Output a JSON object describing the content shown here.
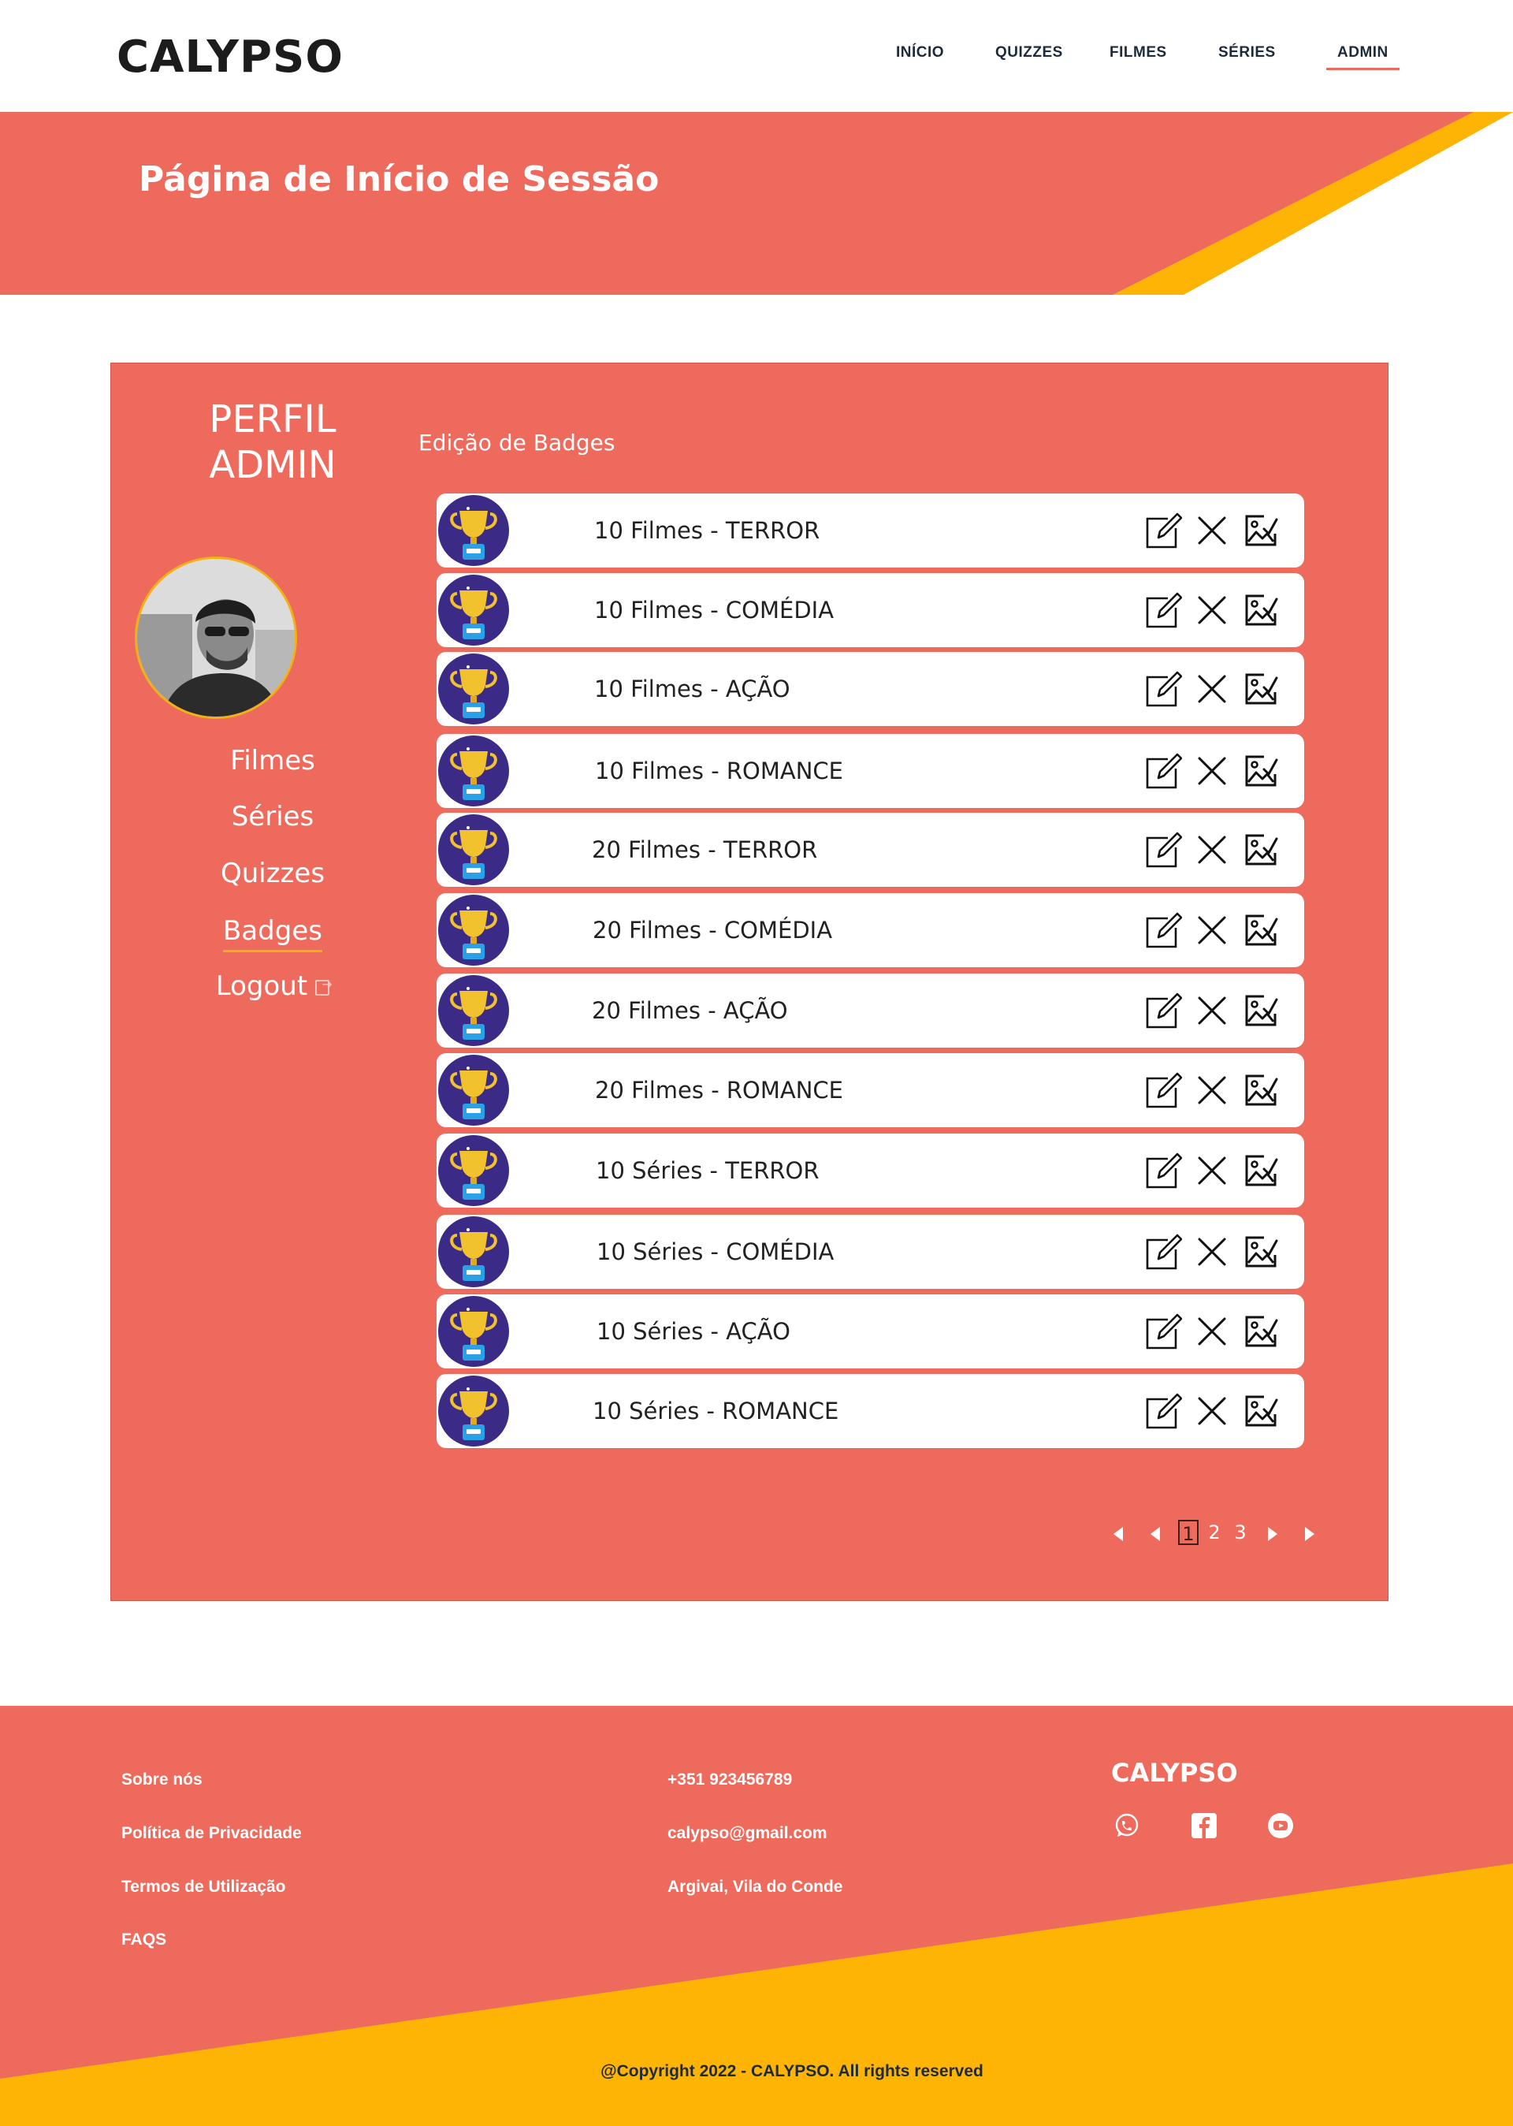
{
  "header": {
    "logo": "CALYPSO",
    "nav": [
      "INÍCIO",
      "QUIZZES",
      "FILMES",
      "SÉRIES",
      "ADMIN"
    ],
    "active_nav": "ADMIN"
  },
  "banner": {
    "title": "Página de Início de Sessão"
  },
  "profile": {
    "title_line1": "PERFIL",
    "title_line2": "ADMIN",
    "menu": [
      "Filmes",
      "Séries",
      "Quizzes",
      "Badges",
      "Logout"
    ],
    "active_menu": "Badges"
  },
  "badges": {
    "section_label": "Edição de Badges",
    "items": [
      "10 Filmes - TERROR",
      "10 Filmes - COMÉDIA",
      "10 Filmes - AÇÃO",
      "10 Filmes - ROMANCE",
      "20 Filmes - TERROR",
      "20 Filmes - COMÉDIA",
      "20 Filmes - AÇÃO",
      "20 Filmes - ROMANCE",
      "10 Séries - TERROR",
      "10 Séries - COMÉDIA",
      "10 Séries - AÇÃO",
      "10 Séries - ROMANCE"
    ],
    "actions": [
      "edit-icon",
      "close-icon",
      "edit-image-icon"
    ]
  },
  "pagination": {
    "pages": [
      "1",
      "2",
      "3"
    ],
    "current": "1"
  },
  "footer": {
    "links": [
      "Sobre nós",
      "Política de Privacidade",
      "Termos de Utilização",
      "FAQS"
    ],
    "contacts": [
      "+351 923456789",
      "calypso@gmail.com",
      "Argivai, Vila do Conde"
    ],
    "brand": "CALYPSO",
    "social": [
      "whatsapp-icon",
      "facebook-icon",
      "youtube-icon"
    ],
    "copyright": "@Copyright 2022 - CALYPSO. All rights reserved"
  },
  "colors": {
    "coral": "#ee6a5c",
    "yellow": "#fdb404",
    "badge_purple": "#3b2a86",
    "trophy_gold": "#f2c12e"
  }
}
